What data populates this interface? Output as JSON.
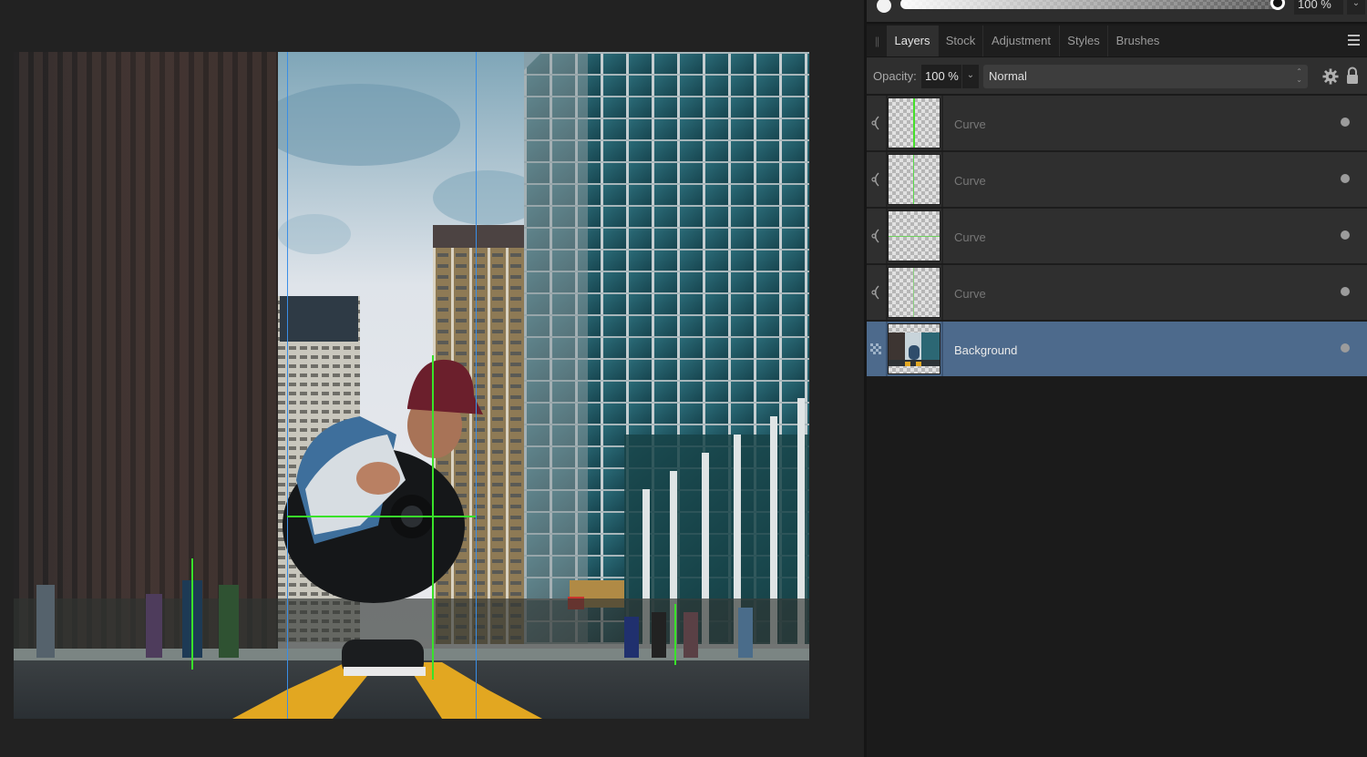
{
  "canvas": {
    "image_description": "Street photo: man in maroon cap crouching on road with camera, skyscrapers on both sides, yellow road lines",
    "guides": {
      "blue_color": "#3a8ee6",
      "green_color": "#39e22a"
    }
  },
  "top_opacity": {
    "value": "100 %"
  },
  "panel": {
    "tabs": [
      {
        "label": "Layers",
        "active": true
      },
      {
        "label": "Stock",
        "active": false
      },
      {
        "label": "Adjustment",
        "active": false
      },
      {
        "label": "Styles",
        "active": false
      },
      {
        "label": "Brushes",
        "active": false
      }
    ],
    "menu_icon": "hamburger-menu-icon",
    "toolbar": {
      "opacity_label": "Opacity:",
      "opacity_value": "100 %",
      "blend_mode": "Normal",
      "gear_icon": "gear-icon",
      "lock_icon": "lock-icon"
    },
    "layers": [
      {
        "name": "Curve",
        "type": "adjustment-curve",
        "thumb_line": "vertical",
        "selected": false
      },
      {
        "name": "Curve",
        "type": "adjustment-curve",
        "thumb_line": "vertical",
        "selected": false
      },
      {
        "name": "Curve",
        "type": "adjustment-curve",
        "thumb_line": "horizontal",
        "selected": false
      },
      {
        "name": "Curve",
        "type": "adjustment-curve",
        "thumb_line": "vertical-faint",
        "selected": false
      },
      {
        "name": "Background",
        "type": "pixel",
        "thumb_line": "none",
        "selected": true
      }
    ],
    "selected_color": "#4d6a8c"
  }
}
